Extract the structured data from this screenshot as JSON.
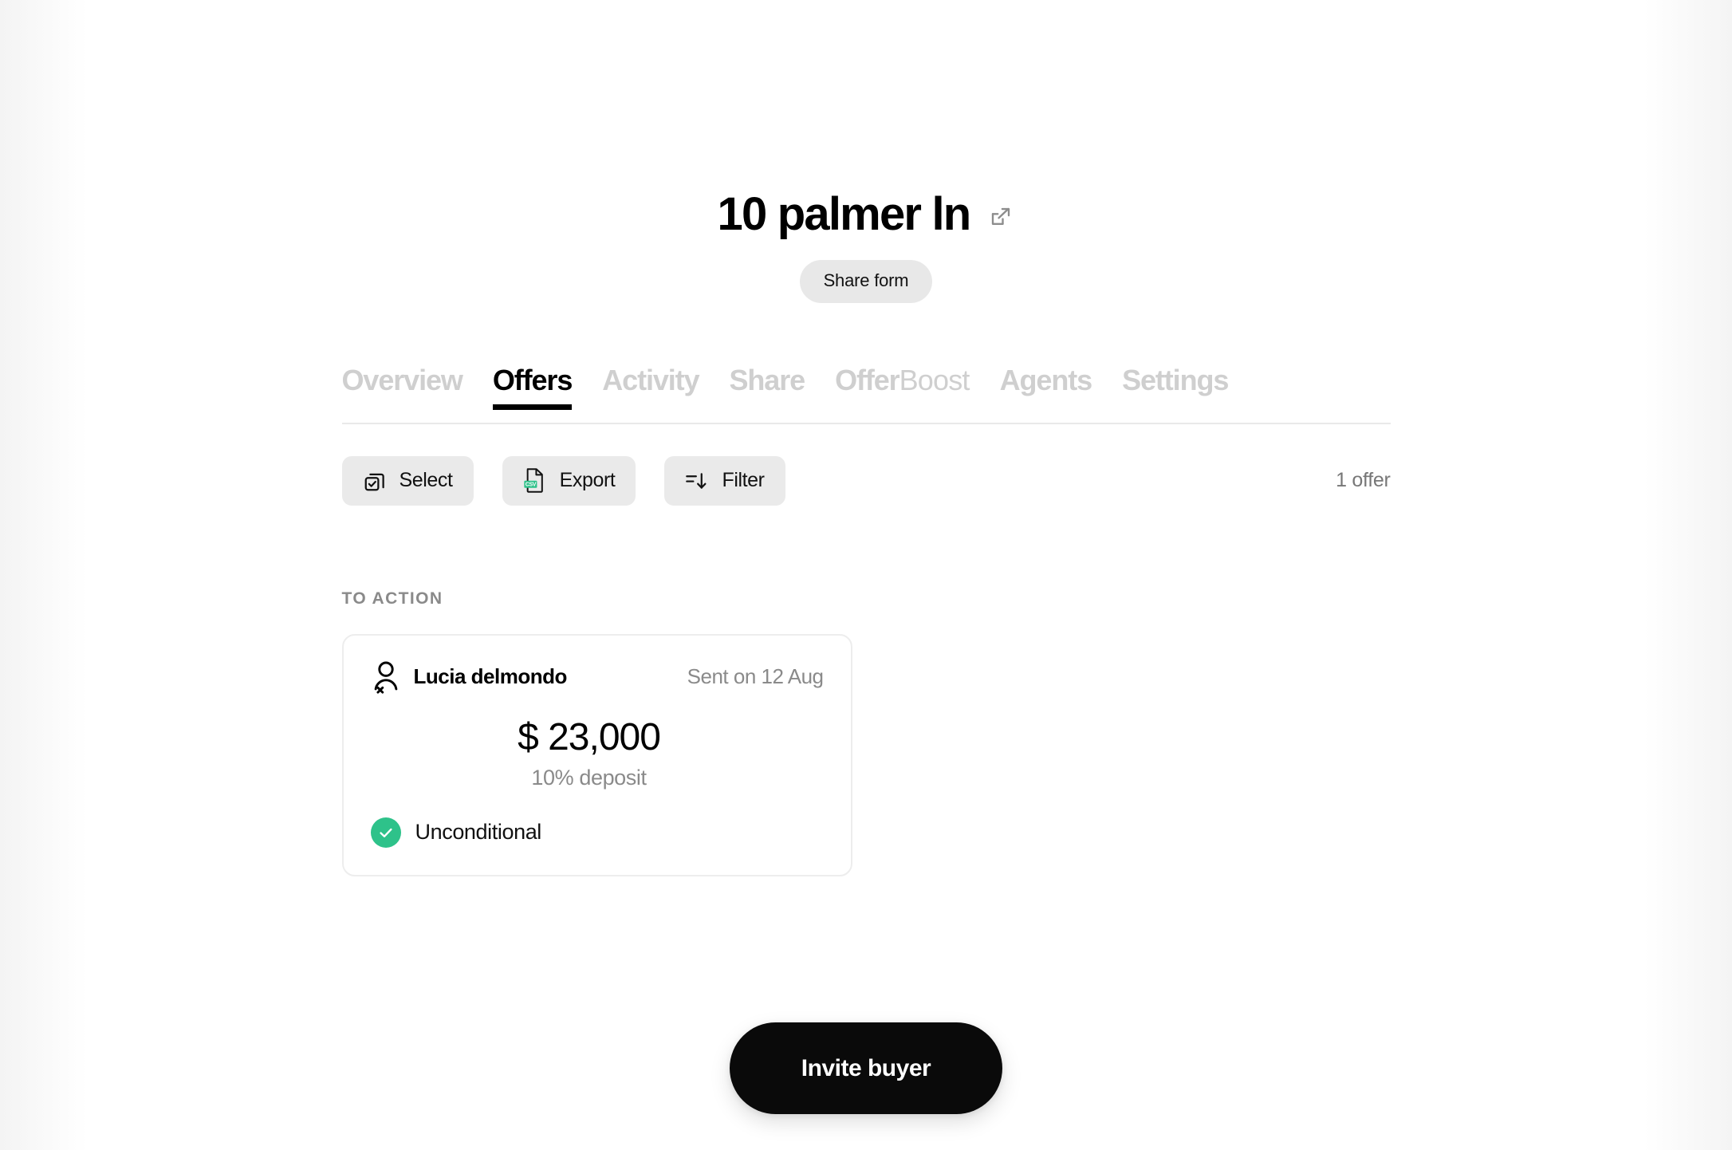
{
  "header": {
    "title": "10 palmer ln",
    "external_link_icon": "external-link-icon",
    "share_form_label": "Share form"
  },
  "tabs": [
    {
      "label": "Overview",
      "active": false
    },
    {
      "label": "Offers",
      "active": true
    },
    {
      "label": "Activity",
      "active": false
    },
    {
      "label": "Share",
      "active": false
    },
    {
      "label": "OfferBoost",
      "label_strong": "Offer",
      "label_soft": "Boost",
      "active": false
    },
    {
      "label": "Agents",
      "active": false
    },
    {
      "label": "Settings",
      "active": false
    }
  ],
  "toolbar": {
    "select_label": "Select",
    "select_icon": "select-stack-check-icon",
    "export_label": "Export",
    "export_icon": "csv-file-icon",
    "export_badge": "CSV",
    "filter_label": "Filter",
    "filter_icon": "sort-descending-icon",
    "offer_count": "1 offer"
  },
  "list": {
    "section_label": "TO ACTION",
    "offers": [
      {
        "buyer_icon": "user-x-icon",
        "buyer_name": "Lucia delmondo",
        "sent_on": "Sent on 12 Aug",
        "amount": "$ 23,000",
        "deposit": "10% deposit",
        "condition": "Unconditional",
        "condition_icon": "check-circle-icon"
      }
    ]
  },
  "cta": {
    "invite_label": "Invite buyer"
  },
  "colors": {
    "accent_green": "#2ec28a",
    "active_tab": "#000000",
    "inactive_tab": "#cfcfcf",
    "muted_text": "#8a8a8a",
    "chip_bg": "#eaeaea",
    "cta_bg": "#0a0a0a"
  }
}
